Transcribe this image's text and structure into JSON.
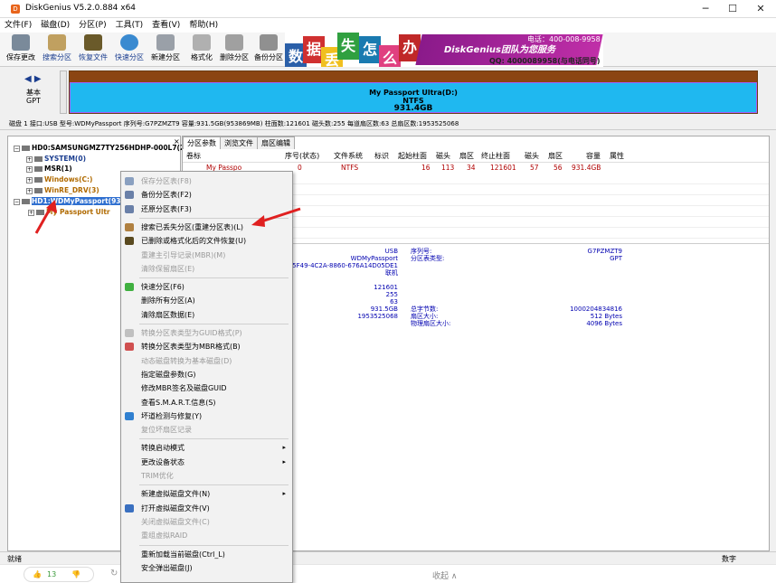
{
  "window": {
    "title": "DiskGenius V5.2.0.884 x64",
    "controls": [
      "─",
      "☐",
      "✕"
    ]
  },
  "menu": [
    "文件(F)",
    "磁盘(D)",
    "分区(P)",
    "工具(T)",
    "查看(V)",
    "帮助(H)"
  ],
  "toolbar": [
    {
      "label": "保存更改",
      "icon": "save-icon",
      "color": "#7a8a9a"
    },
    {
      "label": "搜索分区",
      "icon": "search-icon",
      "color": "#c0a060"
    },
    {
      "label": "恢复文件",
      "icon": "recover-icon",
      "color": "#6a5a2a"
    },
    {
      "label": "快速分区",
      "icon": "quick-partition-icon",
      "color": "#3a8ad0"
    },
    {
      "label": "新建分区",
      "icon": "new-partition-icon",
      "color": "#9aa0a8"
    },
    {
      "label": "格式化",
      "icon": "format-icon",
      "color": "#b0b0b0"
    },
    {
      "label": "删除分区",
      "icon": "delete-icon",
      "color": "#a0a0a0"
    },
    {
      "label": "备份分区",
      "icon": "backup-icon",
      "color": "#909090"
    }
  ],
  "banner": {
    "chars": [
      {
        "t": "数",
        "c": "#2a5fa8"
      },
      {
        "t": "据",
        "c": "#d03030"
      },
      {
        "t": "丢",
        "c": "#f0c020"
      },
      {
        "t": "失",
        "c": "#30a040"
      },
      {
        "t": "怎",
        "c": "#1a7ab0"
      },
      {
        "t": "么",
        "c": "#e04080"
      },
      {
        "t": "办",
        "c": "#c02828"
      }
    ],
    "team": "DiskGenius团队为您服务",
    "phone": "电话：400-008-9958",
    "qq": "QQ: 4000089958(与电话同号)"
  },
  "disk_panel": {
    "nav": "◀ ▶",
    "type_line1": "基本",
    "type_line2": "GPT",
    "partition_name": "My Passport Ultra(D:)",
    "fs": "NTFS",
    "size": "931.4GB"
  },
  "info_line": "磁盘 1 接口:USB  型号:WDMyPassport  序列号:G7PZMZT9  容量:931.5GB(953869MB)  柱面数:121601  磁头数:255  每道扇区数:63  总扇区数:1953525068",
  "tree": {
    "close": "×",
    "items": [
      {
        "text": "HD0:SAMSUNGMZ7TY256HDHP-000L7(23",
        "color": "#000",
        "sel": false
      },
      {
        "text": "SYSTEM(0)",
        "color": "#1a3d8f",
        "sel": false
      },
      {
        "text": "MSR(1)",
        "color": "#000",
        "sel": false
      },
      {
        "text": "Windows(C:)",
        "color": "#b06a00",
        "sel": false
      },
      {
        "text": "WinRE_DRV(3)",
        "color": "#b06a00",
        "sel": false
      },
      {
        "text": "HD1:WDMyPassport(93",
        "color": "#fff",
        "sel": true
      },
      {
        "text": "My Passport Ultr",
        "color": "#b06a00",
        "sel": false
      }
    ]
  },
  "tabs": [
    "分区参数",
    "浏览文件",
    "扇区编辑"
  ],
  "table": {
    "headers": [
      "卷标",
      "序号(状态)",
      "文件系统",
      "标识",
      "起始柱面",
      "磁头",
      "扇区",
      "终止柱面",
      "磁头",
      "扇区",
      "容量",
      "属性"
    ],
    "row": [
      "My Passpo",
      "0",
      "NTFS",
      "",
      "16",
      "113",
      "34",
      "121601",
      "57",
      "56",
      "931.4GB",
      ""
    ]
  },
  "details": {
    "left_vals": [
      "USB",
      "WDMyPassport",
      "C5F1D001-5F49-4C2A-8860-676A14D05DE1",
      "联机",
      "",
      "121601",
      "255",
      "63",
      "931.5GB",
      "1953525068"
    ],
    "mid_labels": [
      "序列号:",
      "分区表类型:",
      "",
      "",
      "",
      "",
      "",
      "",
      "总字节数:",
      "扇区大小:",
      "物理扇区大小:"
    ],
    "right_vals": [
      "G7PZMZT9",
      "GPT",
      "",
      "",
      "",
      "",
      "",
      "",
      "1000204834816",
      "512 Bytes",
      "4096 Bytes"
    ]
  },
  "status": {
    "left": "就绪",
    "right": "数字"
  },
  "bottom": {
    "likes": "13",
    "collapse": "收起 ∧"
  },
  "context_menu": [
    {
      "label": "保存分区表(F8)",
      "dis": true,
      "icon": "save-table-icon",
      "c": "#8aa0c0"
    },
    {
      "label": "备份分区表(F2)",
      "dis": false,
      "icon": "backup-table-icon",
      "c": "#6a80a8"
    },
    {
      "label": "还原分区表(F3)",
      "dis": false,
      "icon": "restore-table-icon",
      "c": "#6a80a8"
    },
    {
      "sep": true
    },
    {
      "label": "搜索已丢失分区(重建分区表)(L)",
      "dis": false,
      "icon": "search-lost-icon",
      "c": "#b08040"
    },
    {
      "label": "已删除或格式化后的文件恢复(U)",
      "dis": false,
      "icon": "file-recover-icon",
      "c": "#5a4a20"
    },
    {
      "label": "重建主引导记录(MBR)(M)",
      "dis": true,
      "icon": "",
      "c": ""
    },
    {
      "label": "清除保留扇区(E)",
      "dis": true,
      "icon": "",
      "c": ""
    },
    {
      "sep": true
    },
    {
      "label": "快速分区(F6)",
      "dis": false,
      "icon": "quick-part-icon",
      "c": "#40b040"
    },
    {
      "label": "删除所有分区(A)",
      "dis": false,
      "icon": "",
      "c": ""
    },
    {
      "label": "清除扇区数据(E)",
      "dis": false,
      "icon": "",
      "c": ""
    },
    {
      "sep": true
    },
    {
      "label": "转换分区表类型为GUID格式(P)",
      "dis": true,
      "icon": "guid-icon",
      "c": "#c0c0c0"
    },
    {
      "label": "转换分区表类型为MBR格式(B)",
      "dis": false,
      "icon": "mbr-icon",
      "c": "#d05050"
    },
    {
      "label": "动态磁盘转换为基本磁盘(D)",
      "dis": true,
      "icon": "",
      "c": ""
    },
    {
      "label": "指定磁盘参数(G)",
      "dis": false,
      "icon": "",
      "c": ""
    },
    {
      "label": "修改MBR签名及磁盘GUID",
      "dis": false,
      "icon": "",
      "c": ""
    },
    {
      "label": "查看S.M.A.R.T.信息(S)",
      "dis": false,
      "icon": "",
      "c": ""
    },
    {
      "label": "坏道检测与修复(Y)",
      "dis": false,
      "icon": "tools-icon",
      "c": "#3080d0"
    },
    {
      "label": "复位坏扇区记录",
      "dis": true,
      "icon": "",
      "c": ""
    },
    {
      "sep": true
    },
    {
      "label": "转换启动模式",
      "dis": false,
      "icon": "",
      "c": "",
      "sub": true
    },
    {
      "label": "更改设备状态",
      "dis": false,
      "icon": "",
      "c": "",
      "sub": true
    },
    {
      "label": "TRIM优化",
      "dis": true,
      "icon": "",
      "c": ""
    },
    {
      "sep": true
    },
    {
      "label": "新建虚拟磁盘文件(N)",
      "dis": false,
      "icon": "",
      "c": "",
      "sub": true
    },
    {
      "label": "打开虚拟磁盘文件(V)",
      "dis": false,
      "icon": "vdisk-icon",
      "c": "#3a70c0"
    },
    {
      "label": "关闭虚拟磁盘文件(C)",
      "dis": true,
      "icon": "",
      "c": ""
    },
    {
      "label": "重组虚拟RAID",
      "dis": true,
      "icon": "",
      "c": ""
    },
    {
      "sep": true
    },
    {
      "label": "重新加载当前磁盘(Ctrl_L)",
      "dis": false,
      "icon": "",
      "c": ""
    },
    {
      "label": "安全弹出磁盘(J)",
      "dis": false,
      "icon": "",
      "c": ""
    }
  ]
}
